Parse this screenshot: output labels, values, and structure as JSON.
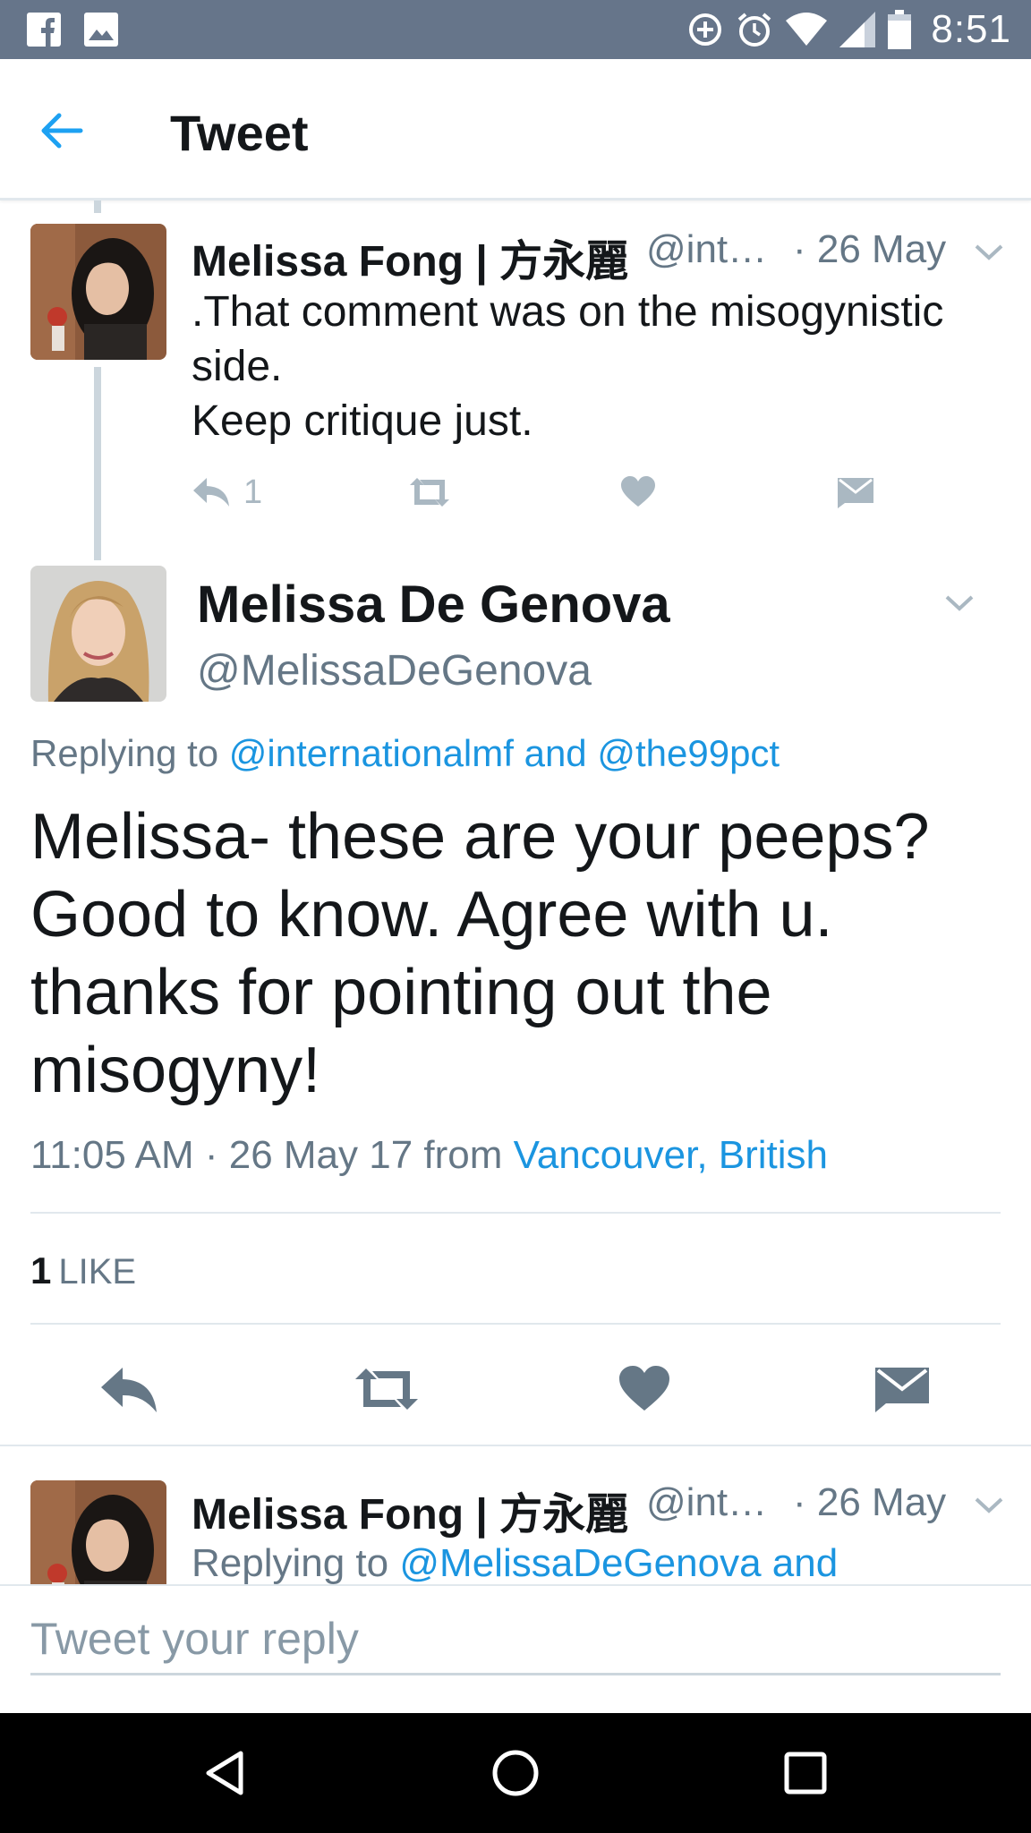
{
  "status_bar": {
    "time": "8:51",
    "left_icons": [
      "facebook-icon",
      "image-icon"
    ],
    "right_icons": [
      "data-saver-icon",
      "alarm-icon",
      "wifi-icon",
      "signal-icon",
      "battery-icon"
    ]
  },
  "header": {
    "title": "Tweet",
    "back_icon": "arrow-left-icon"
  },
  "parent_tweet": {
    "name": "Melissa Fong | 方永麗",
    "handle": "@inte…",
    "date": "· 26 May",
    "text": ".That comment was on the misogynistic side.\nKeep critique just.",
    "reply_count": "1"
  },
  "main_tweet": {
    "name": "Melissa De Genova",
    "handle": "@MelissaDeGenova",
    "replying_prefix": "Replying to",
    "replying_targets": "@internationalmf and @the99pct",
    "text": "Melissa- these are your peeps? Good to know. Agree with u. thanks for pointing out the misogyny!",
    "timestamp": "11:05 AM · 26 May 17 from",
    "location": "Vancouver, British",
    "likes_count": "1",
    "likes_label": "LIKE"
  },
  "next_reply": {
    "name": "Melissa Fong | 方永麗",
    "handle": "@inte…",
    "date": "· 26 May",
    "replying_prefix": "Replying to",
    "replying_targets": "@MelissaDeGenova and"
  },
  "composer": {
    "placeholder": "Tweet your reply"
  },
  "colors": {
    "status_bar": "#66758a",
    "accent": "#1da1f2",
    "link": "#1b95e0",
    "secondary_text": "#657786",
    "action_icon_muted": "#aab8c2",
    "action_icon_main": "#657786"
  }
}
